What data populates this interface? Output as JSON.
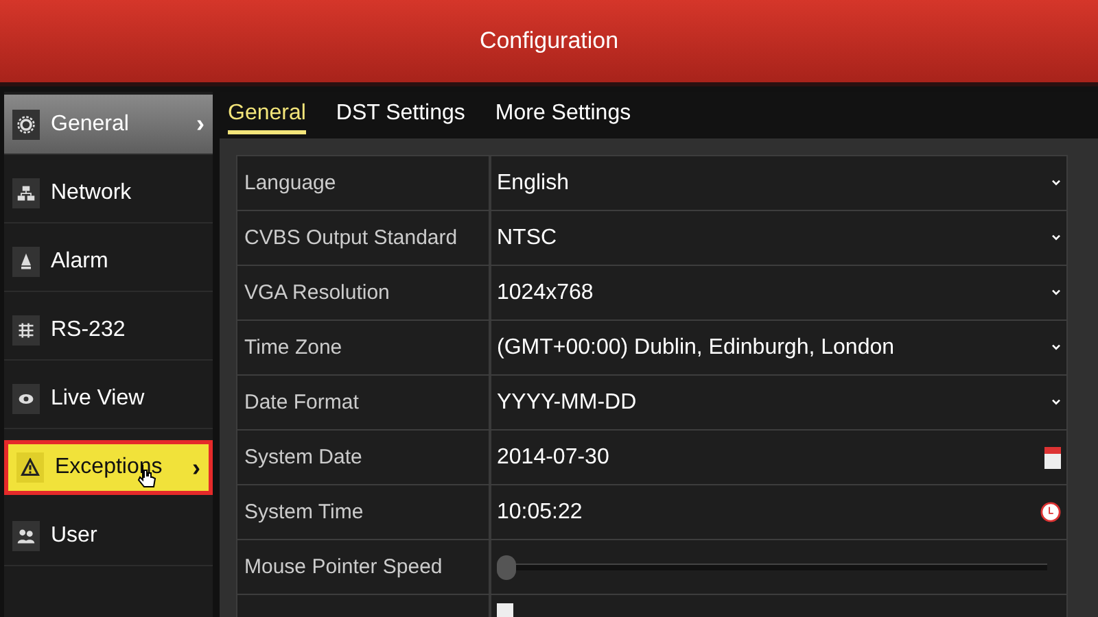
{
  "window": {
    "title": "Configuration"
  },
  "sidebar": {
    "items": [
      {
        "label": "General",
        "selected": true,
        "highlighted": false,
        "arrow": "›"
      },
      {
        "label": "Network",
        "selected": false,
        "highlighted": false
      },
      {
        "label": "Alarm",
        "selected": false,
        "highlighted": false
      },
      {
        "label": "RS-232",
        "selected": false,
        "highlighted": false
      },
      {
        "label": "Live View",
        "selected": false,
        "highlighted": false
      },
      {
        "label": "Exceptions",
        "selected": false,
        "highlighted": true,
        "arrow": "›"
      },
      {
        "label": "User",
        "selected": false,
        "highlighted": false
      }
    ]
  },
  "tabs": [
    {
      "label": "General",
      "selected": true
    },
    {
      "label": "DST Settings",
      "selected": false
    },
    {
      "label": "More Settings",
      "selected": false
    }
  ],
  "settings": [
    {
      "kind": "dropdown",
      "label": "Language",
      "value": "English"
    },
    {
      "kind": "dropdown",
      "label": "CVBS Output Standard",
      "value": "NTSC"
    },
    {
      "kind": "dropdown",
      "label": "VGA Resolution",
      "value": "1024x768"
    },
    {
      "kind": "dropdown",
      "label": "Time Zone",
      "value": "(GMT+00:00) Dublin, Edinburgh, London"
    },
    {
      "kind": "dropdown",
      "label": "Date Format",
      "value": "YYYY-MM-DD"
    },
    {
      "kind": "date",
      "label": "System Date",
      "value": "2014-07-30"
    },
    {
      "kind": "time",
      "label": "System Time",
      "value": "10:05:22"
    },
    {
      "kind": "slider",
      "label": "Mouse Pointer Speed",
      "level": 0
    },
    {
      "kind": "checkbox",
      "checked": false
    }
  ]
}
